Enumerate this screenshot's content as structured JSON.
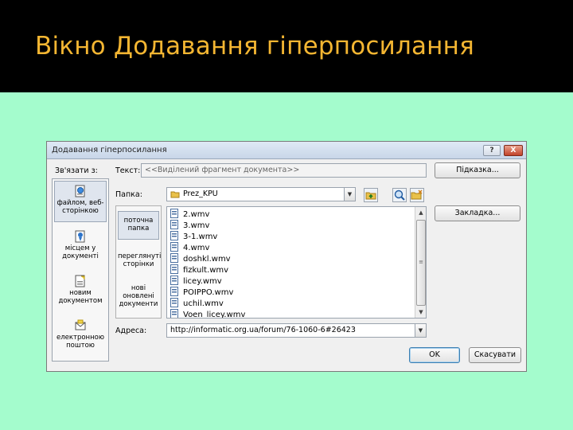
{
  "slide": {
    "title": "Вікно Додавання гіперпосилання",
    "title_color": "#f4b632",
    "background_color": "#a4fccd"
  },
  "dialog": {
    "title": "Додавання гіперпосилання",
    "help_button": "?",
    "close_button": "X",
    "link_to_label": "Зв'язати з:",
    "text_label": "Текст:",
    "text_value": "<<Виділений фрагмент документа>>",
    "tooltip_button": "Підказка...",
    "folder_label": "Папка:",
    "folder_value": "Prez_KPU",
    "bookmark_button": "Закладка...",
    "address_label": "Адреса:",
    "address_value": "http://informatic.org.ua/forum/76-1060-6#26423",
    "ok_button": "OK",
    "cancel_button": "Скасувати",
    "link_bar": [
      {
        "label": "файлом, веб-сторінкою",
        "icon": "web-page-icon",
        "selected": true
      },
      {
        "label": "місцем у документі",
        "icon": "place-in-document-icon",
        "selected": false
      },
      {
        "label": "новим документом",
        "icon": "new-document-icon",
        "selected": false
      },
      {
        "label": "електронною поштою",
        "icon": "email-icon",
        "selected": false
      }
    ],
    "sub_bar": [
      {
        "label": "поточна папка",
        "selected": true
      },
      {
        "label": "переглянуті сторінки",
        "selected": false
      },
      {
        "label": "нові оновлені документи",
        "selected": false
      }
    ],
    "files": [
      "2.wmv",
      "3.wmv",
      "3-1.wmv",
      "4.wmv",
      "doshkl.wmv",
      "fizkult.wmv",
      "licey.wmv",
      "POIPPO.wmv",
      "uchil.wmv",
      "Voen_licey.wmv"
    ],
    "toolbar_icons": [
      "folder-up-icon",
      "browse-web-icon",
      "browse-file-icon"
    ]
  }
}
